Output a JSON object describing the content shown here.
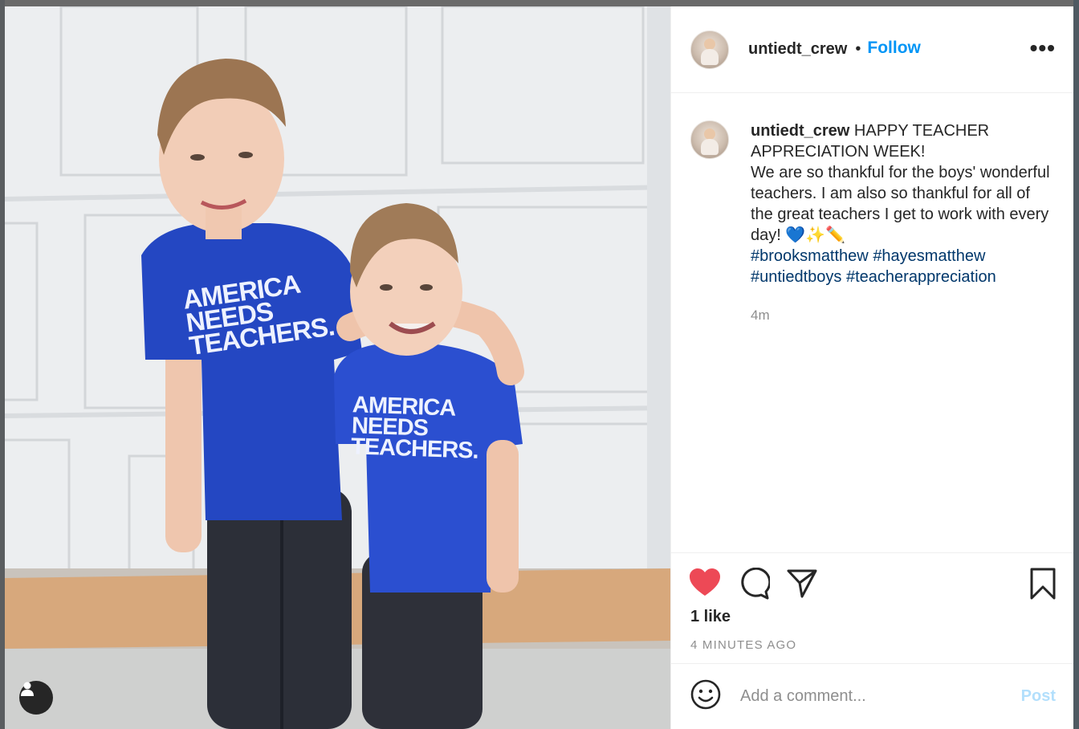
{
  "post": {
    "username": "untiedt_crew",
    "follow_label": "Follow",
    "separator": "•",
    "more_label": "•••"
  },
  "caption": {
    "username": "untiedt_crew",
    "text": "HAPPY TEACHER APPRECIATION WEEK!\nWe are so thankful for the boys' wonderful teachers. I am also so thankful for all of the great teachers I get to work with every day! 💙✨✏️",
    "hashtags": [
      "#brooksmatthew",
      "#hayesmatthew",
      "#untiedtboys",
      "#teacherappreciation"
    ],
    "time": "4m"
  },
  "photo": {
    "shirt_big_lines": [
      "AMERICA",
      "NEEDS",
      "TEACHERS."
    ],
    "shirt_small_lines": [
      "AMERICA",
      "NEEDS",
      "TEACHERS."
    ]
  },
  "actions": {
    "liked": true,
    "likes_label": "1 like",
    "timestamp": "4 MINUTES AGO"
  },
  "comment": {
    "placeholder": "Add a comment...",
    "post_label": "Post"
  },
  "colors": {
    "accent": "#0095f6",
    "like": "#ed4956",
    "hashtag": "#00376b",
    "post_disabled": "#b2dffc"
  },
  "icons": [
    "heart-icon",
    "comment-icon",
    "share-icon",
    "bookmark-icon",
    "emoji-icon",
    "more-icon",
    "user-icon"
  ]
}
